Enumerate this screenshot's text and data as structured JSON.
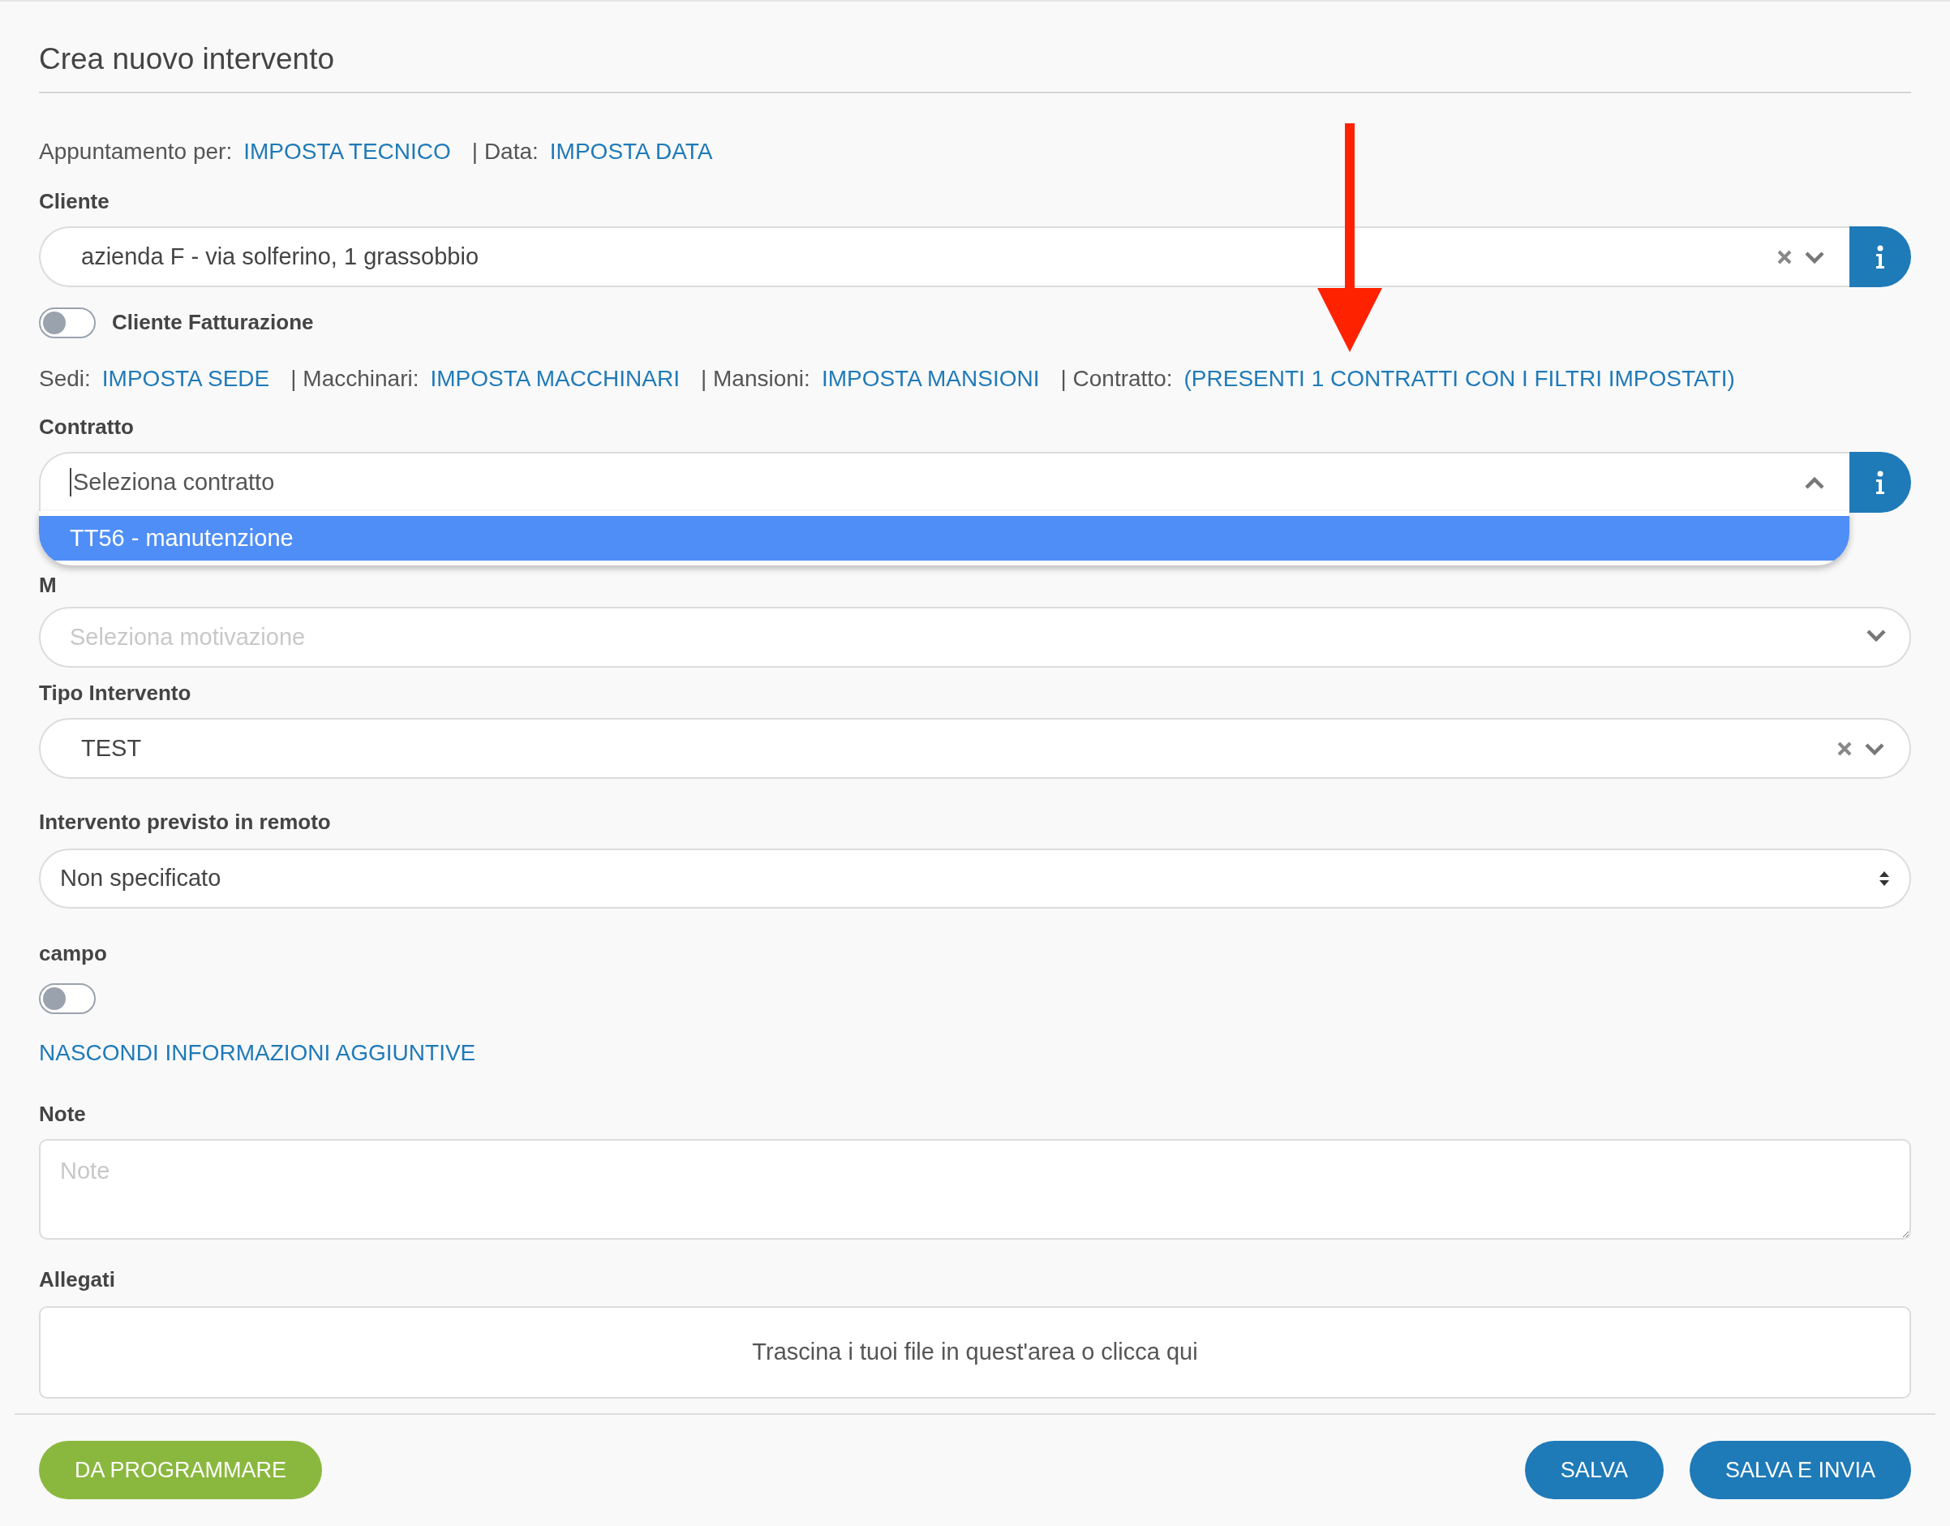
{
  "title": "Crea nuovo intervento",
  "appointment_row": [
    {
      "kind": "label",
      "text": "Appuntamento per:"
    },
    {
      "kind": "link",
      "text": "IMPOSTA TECNICO"
    },
    {
      "kind": "label",
      "text": "| Data:"
    },
    {
      "kind": "link",
      "text": "IMPOSTA DATA"
    }
  ],
  "cliente": {
    "label": "Cliente",
    "value": "azienda F - via solferino, 1 grassobbio"
  },
  "cliente_fatturazione": {
    "label": "Cliente Fatturazione",
    "on": false
  },
  "filters_row": [
    {
      "kind": "label",
      "text": "Sedi:"
    },
    {
      "kind": "link",
      "text": "IMPOSTA SEDE"
    },
    {
      "kind": "label",
      "text": "| Macchinari:"
    },
    {
      "kind": "link",
      "text": "IMPOSTA MACCHINARI"
    },
    {
      "kind": "label",
      "text": "| Mansioni:"
    },
    {
      "kind": "link",
      "text": "IMPOSTA MANSIONI"
    },
    {
      "kind": "label",
      "text": "| Contratto:"
    },
    {
      "kind": "link",
      "text": "(PRESENTI 1 CONTRATTI CON I FILTRI IMPOSTATI)"
    }
  ],
  "contratto": {
    "label": "Contratto",
    "placeholder": "Seleziona contratto",
    "expanded": true,
    "options": [
      {
        "text": "TT56 - manutenzione",
        "selected": true
      }
    ]
  },
  "motivazione": {
    "label": "M",
    "placeholder": "Seleziona motivazione"
  },
  "tipo_intervento": {
    "label": "Tipo Intervento",
    "value": "TEST"
  },
  "remoto": {
    "label": "Intervento previsto in remoto",
    "value": "Non specificato"
  },
  "campo": {
    "label": "campo",
    "on": false
  },
  "toggle_link": "NASCONDI INFORMAZIONI AGGIUNTIVE",
  "note": {
    "label": "Note",
    "placeholder": "Note"
  },
  "allegati": {
    "label": "Allegati",
    "dropzone": "Trascina i tuoi file in quest'area o clicca qui"
  },
  "buttons_left": [
    {
      "text": "DA PROGRAMMARE",
      "kind": "green"
    }
  ],
  "buttons_right": [
    {
      "text": "SALVA",
      "kind": "blue"
    },
    {
      "text": "SALVA E INVIA",
      "kind": "blue"
    }
  ]
}
